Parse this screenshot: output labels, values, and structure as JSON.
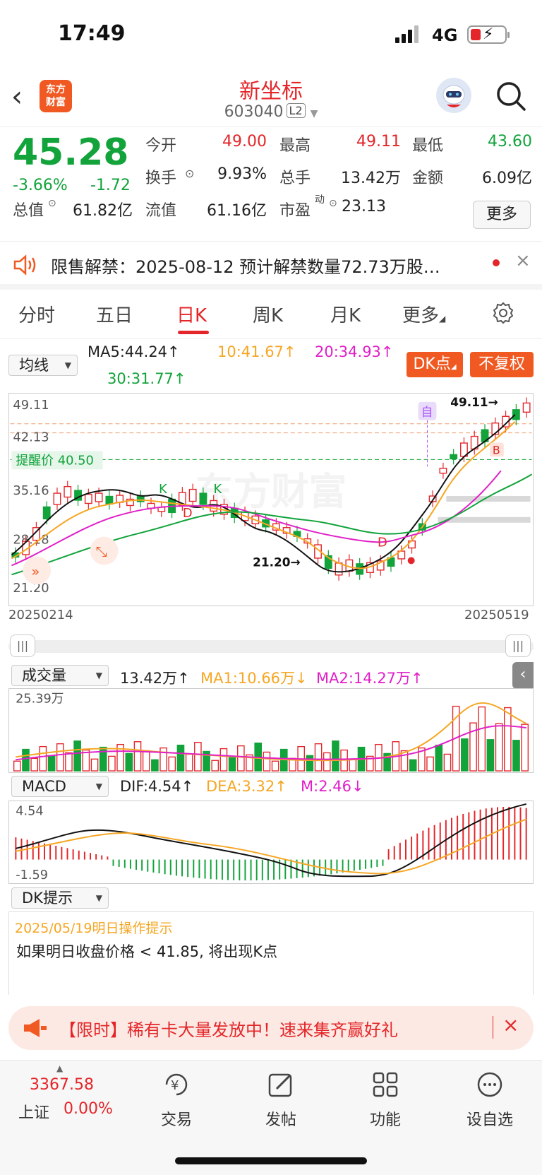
{
  "status_bar": {
    "time": "17:49",
    "network": "4G"
  },
  "header": {
    "logo_text": "东方财富",
    "stock_name": "新坐标",
    "stock_code": "603040",
    "level_badge": "L2"
  },
  "quote": {
    "price": "45.28",
    "change_pct": "-3.66%",
    "change_amt": "-1.72",
    "fields": [
      {
        "label": "今开",
        "value": "49.00",
        "color": "#e4262a"
      },
      {
        "label": "最高",
        "value": "49.11",
        "color": "#e4262a"
      },
      {
        "label": "最低",
        "value": "43.60",
        "color": "#12a33b"
      },
      {
        "label": "换手",
        "value": "9.93%",
        "color": "#222222"
      },
      {
        "label": "总手",
        "value": "13.42万",
        "color": "#222222"
      },
      {
        "label": "金额",
        "value": "6.09亿",
        "color": "#222222"
      },
      {
        "label": "总值",
        "value": "61.82亿",
        "color": "#222222"
      },
      {
        "label": "流值",
        "value": "61.16亿",
        "color": "#222222"
      },
      {
        "label": "市盈",
        "value": "23.13",
        "color": "#222222",
        "superscript": "动"
      }
    ],
    "more_label": "更多"
  },
  "notice": {
    "text": "限售解禁：2025-08-12 预计解禁数量72.73万股…"
  },
  "tabs": [
    "分时",
    "五日",
    "日K",
    "周K",
    "月K",
    "更多"
  ],
  "active_tab": "日K",
  "kline": {
    "ma_selector": "均线",
    "ma5": "MA5:44.24↑",
    "ma10": "10:41.67↑",
    "ma20": "20:34.93↑",
    "ma30": "30:31.77↑",
    "dk_button": "DK点",
    "fuquan_button": "不复权",
    "y_labels": [
      "49.11",
      "42.13",
      "35.16",
      "28.18",
      "21.20"
    ],
    "alert_label": "提醒价 40.50",
    "high_marker": "49.11→",
    "low_marker": "21.20→",
    "date_start": "20250214",
    "date_end": "20250519",
    "watermark": "东方财富",
    "markers": [
      "K",
      "K",
      "D",
      "D",
      "自",
      "B"
    ]
  },
  "volume": {
    "selector": "成交量",
    "vol": "13.42万↑",
    "ma1": "MA1:10.66万↓",
    "ma2": "MA2:14.27万↑",
    "y_label": "25.39万"
  },
  "macd": {
    "selector": "MACD",
    "dif": "DIF:4.54↑",
    "dea": "DEA:3.32↑",
    "m": "M:2.46↓",
    "y_top": "4.54",
    "y_bottom": "-1.59"
  },
  "dk_hint": {
    "selector": "DK提示",
    "date_line": "2025/05/19明日操作提示",
    "text": "如果明日收盘价格 < 41.85, 将出现K点"
  },
  "promo": {
    "text": "【限时】稀有卡大量发放中！速来集齐赢好礼"
  },
  "bottom_nav": {
    "index_value": "3367.58",
    "index_name": "上证",
    "index_change": "0.00%",
    "items": [
      "交易",
      "发帖",
      "功能",
      "设自选"
    ]
  }
}
